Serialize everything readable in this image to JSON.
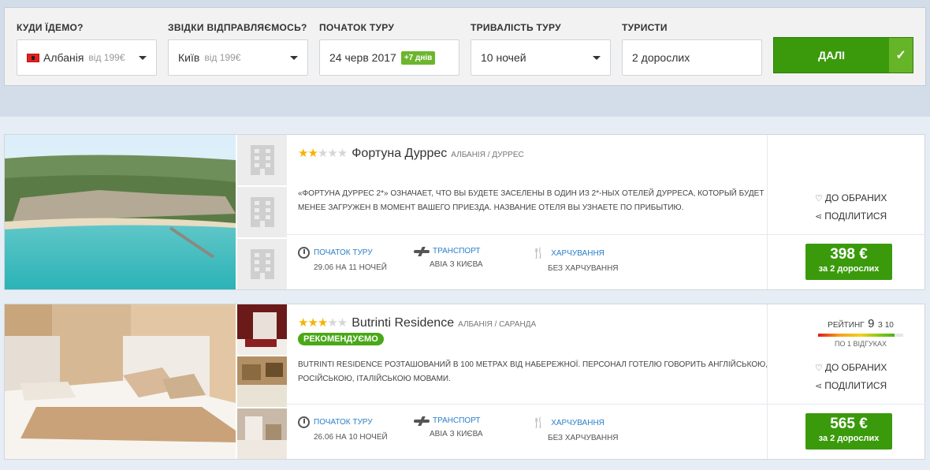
{
  "search": {
    "destination_label": "КУДИ ЇДЕМО?",
    "destination_value": "Албанія",
    "destination_price": "від 199€",
    "origin_label": "ЗВІДКИ ВІДПРАВЛЯЄМОСЬ?",
    "origin_value": "Київ",
    "origin_price": "від 199€",
    "start_label": "ПОЧАТОК ТУРУ",
    "start_value": "24 черв 2017",
    "start_badge": "+7 днів",
    "duration_label": "ТРИВАЛІСТЬ ТУРУ",
    "duration_value": "10 ночей",
    "tourists_label": "ТУРИСТИ",
    "tourists_value": "2 дорослих",
    "next_label": "ДАЛІ",
    "check": "✓"
  },
  "detail_labels": {
    "start": "ПОЧАТОК ТУРУ",
    "transport": "ТРАНСПОРТ",
    "meals": "ХАРЧУВАННЯ",
    "favorite": "ДО ОБРАНИХ",
    "share": "ПОДІЛИТИСЯ"
  },
  "hotels": [
    {
      "stars_on": "★★",
      "stars_off": "★★★",
      "name": "Фортуна Дуррес",
      "location": "АЛБАНІЯ / ДУРРЕС",
      "description": "«ФОРТУНА ДУРРЕС 2*» ОЗНАЧАЕТ, ЧТО ВЫ БУДЕТЕ ЗАСЕЛЕНЫ В ОДИН ИЗ 2*-НЫХ ОТЕЛЕЙ ДУРРЕСА, КОТОРЫЙ БУДЕТ МЕНЕЕ ЗАГРУЖЕН В МОМЕНТ ВАШЕГО ПРИЕЗДА. НАЗВАНИЕ ОТЕЛЯ ВЫ УЗНАЕТЕ ПО ПРИБЫТИЮ.",
      "start_value": "29.06 НА 11 НОЧЕЙ",
      "transport_value": "АВІА З КИЄВА",
      "meals_value": "БЕЗ ХАРЧУВАННЯ",
      "price": "398 €",
      "price_for": "за 2 дорослих"
    },
    {
      "stars_on": "★★★",
      "stars_off": "★★",
      "name": "Butrinti Residence",
      "location": "АЛБАНІЯ / САРАНДА",
      "recommended": "РЕКОМЕНДУЄМО",
      "rating_label": "РЕЙТИНГ",
      "rating_value": "9",
      "rating_of": "з 10",
      "rating_fraction": 0.9,
      "rating_count": "ПО 1 ВІДГУКАХ",
      "description": "BUTRINTI RESIDENCE РОЗТАШОВАНИЙ В 100 МЕТРАХ ВІД НАБЕРЕЖНОЇ. ПЕРСОНАЛ ГОТЕЛЮ ГОВОРИТЬ АНГЛІЙСЬКОЮ, РОСІЙСЬКОЮ, ІТАЛІЙСЬКОЮ МОВАМИ.",
      "start_value": "26.06 НА 10 НОЧЕЙ",
      "transport_value": "АВІА З КИЄВА",
      "meals_value": "БЕЗ ХАРЧУВАННЯ",
      "price": "565 €",
      "price_for": "за 2 дорослих"
    }
  ],
  "icons": {
    "favorite": "♡",
    "share": "share-icon"
  },
  "colors": {
    "accent_green": "#3a9a0c",
    "link_blue": "#2a7fc9",
    "star": "#f5b400"
  }
}
